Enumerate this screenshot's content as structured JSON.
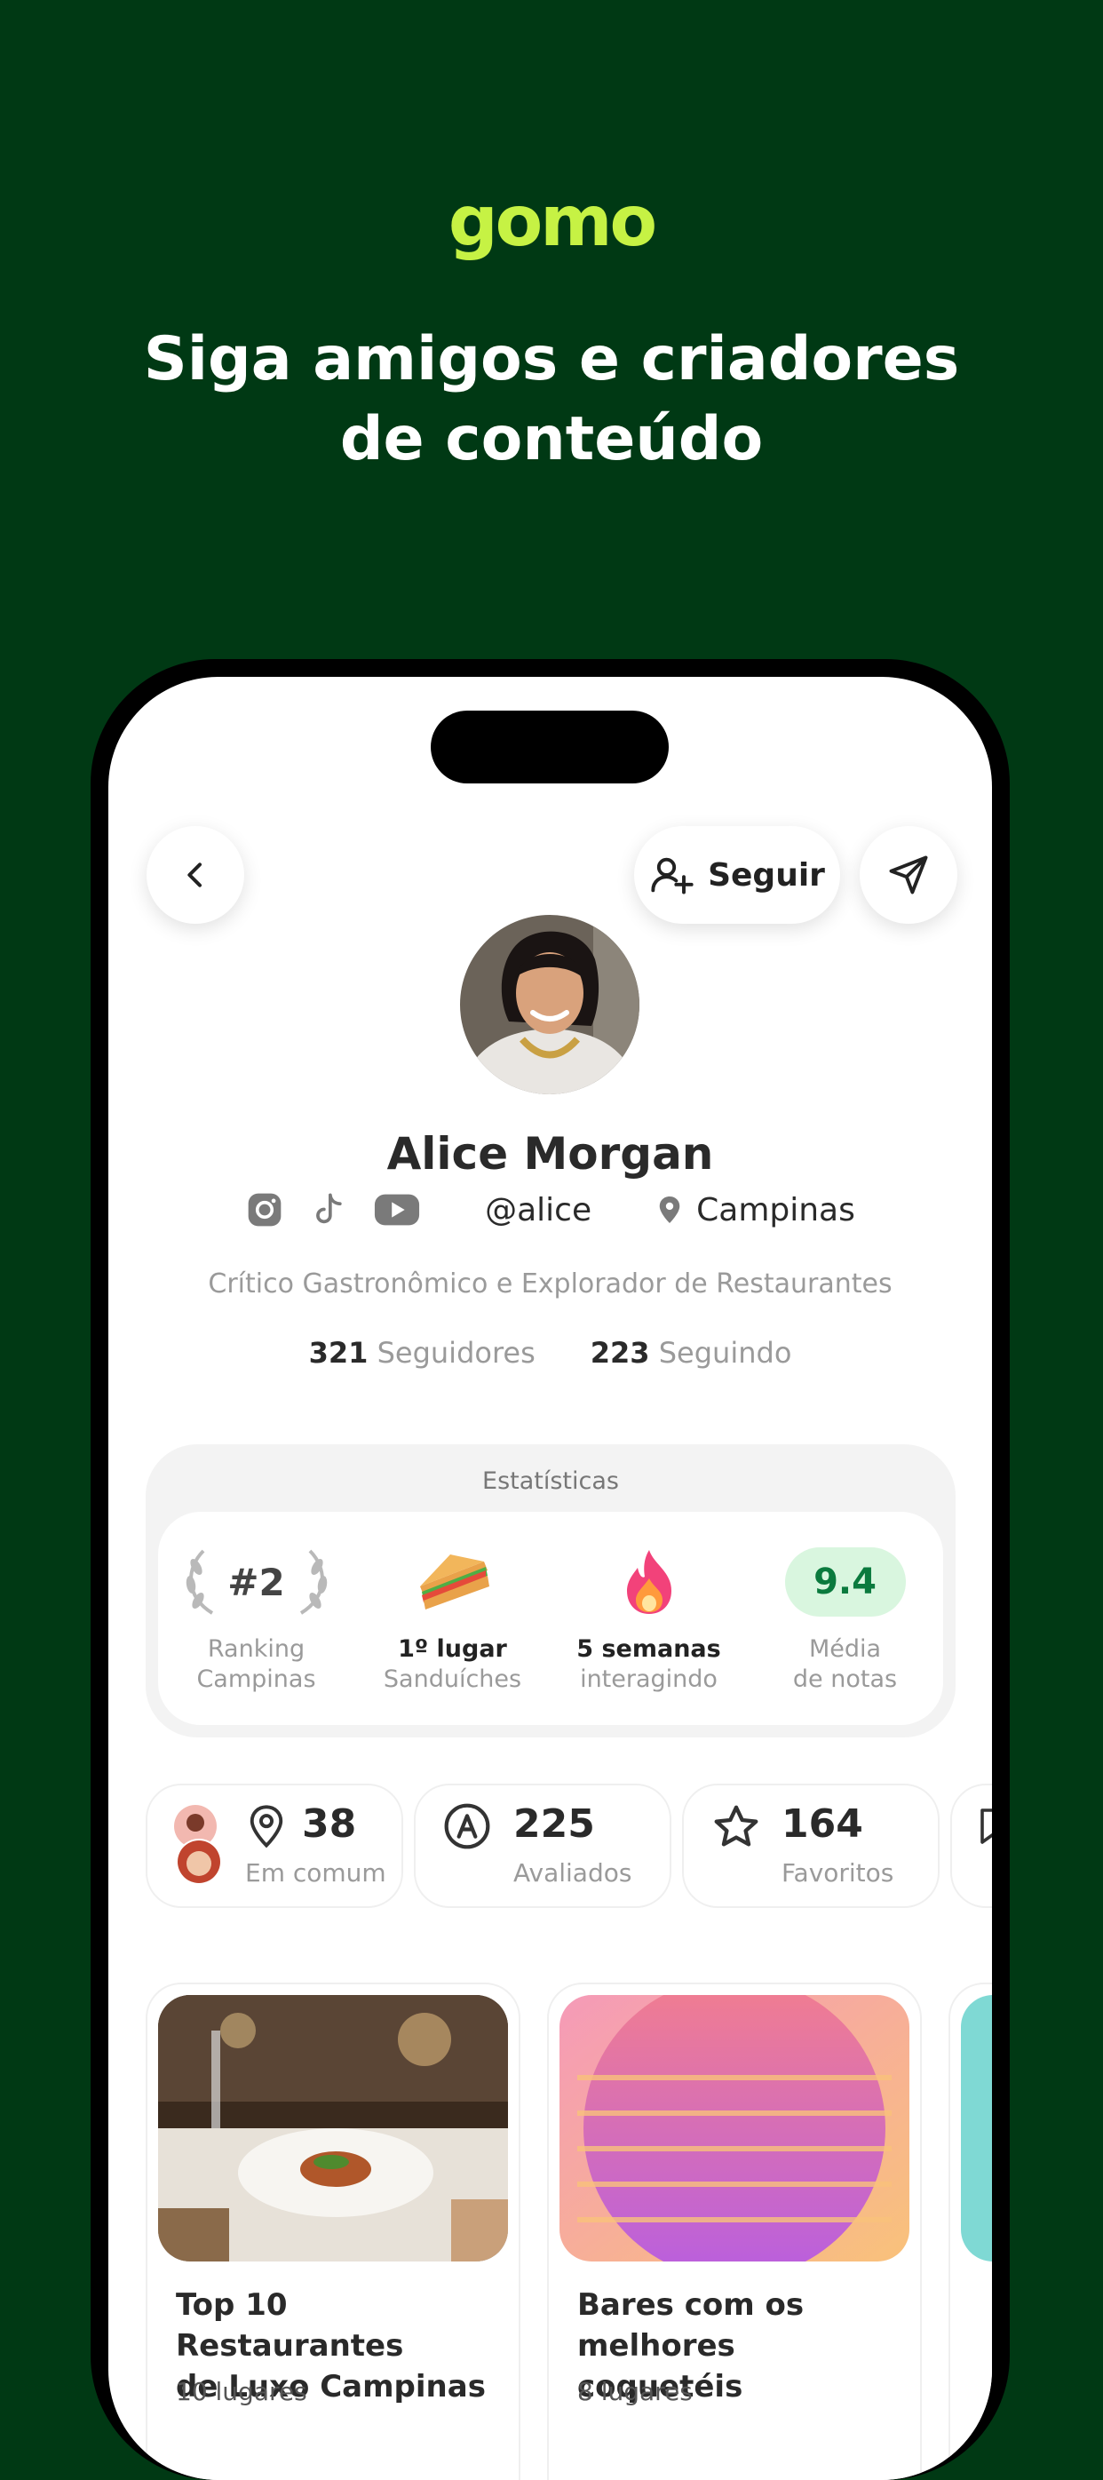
{
  "brand": {
    "logo_text": "gomo"
  },
  "headline": {
    "line1": "Siga amigos e criadores",
    "line2": "de conteúdo"
  },
  "header": {
    "follow_label": "Seguir"
  },
  "profile": {
    "name": "Alice Morgan",
    "handle": "@alice",
    "location": "Campinas",
    "bio": "Crítico Gastronômico e Explorador de Restaurantes",
    "followers_count": "321",
    "followers_label": "Seguidores",
    "following_count": "223",
    "following_label": "Seguindo"
  },
  "stats": {
    "title": "Estatísticas",
    "ranking": {
      "value": "#2",
      "line1": "Ranking",
      "line2": "Campinas"
    },
    "sandwich": {
      "line1": "1º lugar",
      "line2": "Sanduíches"
    },
    "streak": {
      "line1": "5 semanas",
      "line2": "interagindo"
    },
    "average": {
      "value": "9.4",
      "line1": "Média",
      "line2": "de notas"
    }
  },
  "summary_cards": [
    {
      "value": "38",
      "label": "Em comum",
      "icon": "pin-icon"
    },
    {
      "value": "225",
      "label": "Avaliados",
      "icon": "rated-icon"
    },
    {
      "value": "164",
      "label": "Favoritos",
      "icon": "star-icon"
    }
  ],
  "lists": [
    {
      "title_line1": "Top 10 Restaurantes",
      "title_line2": "de Luxo Campinas",
      "count": "10 lugares"
    },
    {
      "title_line1": "Bares com os",
      "title_line2": "melhores coquetéis",
      "count": "8 lugares"
    }
  ],
  "colors": {
    "background": "#003914",
    "logo": "#c6f244",
    "score_bg": "#d9f6df",
    "score_text": "#0b7a3e"
  }
}
